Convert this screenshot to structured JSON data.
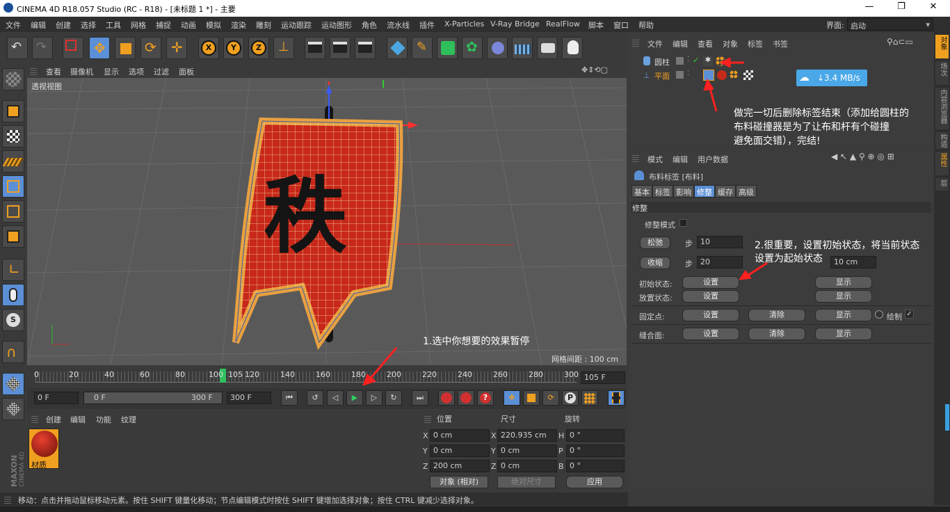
{
  "app": {
    "title": "CINEMA 4D R18.057 Studio (RC - R18) - [未标题 1 *] - 主要",
    "window_controls": [
      "—",
      "❐",
      "✕"
    ]
  },
  "menubar": {
    "items": [
      "文件",
      "编辑",
      "创建",
      "选择",
      "工具",
      "网格",
      "捕捉",
      "动画",
      "模拟",
      "渲染",
      "雕刻",
      "运动跟踪",
      "运动图形",
      "角色",
      "流水线",
      "插件",
      "X-Particles",
      "V-Ray Bridge",
      "RealFlow",
      "脚本",
      "窗口",
      "帮助"
    ],
    "layout_label": "界面:",
    "layout_value": "启动"
  },
  "viewport": {
    "menu": [
      "查看",
      "摄像机",
      "显示",
      "选项",
      "过滤",
      "面板"
    ],
    "view_name": "透视视图",
    "grid_info": "网格间距 : 100 cm",
    "flag_text": "秩"
  },
  "timeline": {
    "ticks": [
      "0",
      "20",
      "40",
      "60",
      "80",
      "100",
      "105",
      "120",
      "140",
      "160",
      "180",
      "200",
      "220",
      "240",
      "260",
      "280",
      "300"
    ],
    "current_frame": "105 F",
    "progress": 0.35
  },
  "transport": {
    "start": "0 F",
    "range_start": "0 F",
    "range_end": "300 F",
    "end": "300 F"
  },
  "material_panel": {
    "menu": [
      "创建",
      "编辑",
      "功能",
      "纹理"
    ],
    "material_name": "材质"
  },
  "coords": {
    "headers": [
      "位置",
      "尺寸",
      "旋转"
    ],
    "rows": [
      {
        "axis": "X",
        "pos": "0 cm",
        "size_axis": "X",
        "size": "220.935 cm",
        "rot_axis": "H",
        "rot": "0 °"
      },
      {
        "axis": "Y",
        "pos": "0 cm",
        "size_axis": "Y",
        "size": "0 cm",
        "rot_axis": "P",
        "rot": "0 °"
      },
      {
        "axis": "Z",
        "pos": "200 cm",
        "size_axis": "Z",
        "size": "0 cm",
        "rot_axis": "B",
        "rot": "0 °"
      }
    ],
    "mode": "对象 (相对)",
    "size_mode": "绝对尺寸",
    "apply": "应用"
  },
  "object_manager": {
    "menu": [
      "文件",
      "编辑",
      "查看",
      "对象",
      "标签",
      "书签"
    ],
    "objects": [
      {
        "name": "圆柱"
      },
      {
        "name": "平面"
      }
    ],
    "speed_badge": "3.4 MB/s"
  },
  "side_tabs": [
    "对象",
    "场次",
    "内容浏览器",
    "构造",
    "属性",
    "层"
  ],
  "attr_manager": {
    "menu": [
      "模式",
      "编辑",
      "用户数据"
    ],
    "tag_title": "布料标签 [布料]",
    "tabs": [
      "基本",
      "标签",
      "影响",
      "修整",
      "缓存",
      "高级"
    ],
    "active_tab": "修整",
    "section": "修整",
    "dress_mode_label": "修整模式",
    "relax_btn": "松弛",
    "step_label": "步",
    "relax_steps": "10",
    "shrink_btn": "收缩",
    "shrink_steps": "20",
    "width_value": "10 cm",
    "init_state_label": "初始状态:",
    "place_state_label": "放置状态:",
    "fix_points_label": "固定点:",
    "seam_label": "缝合面:",
    "set_btn": "设置",
    "show_btn": "显示",
    "clear_btn": "清除",
    "draw_label": "绘制"
  },
  "annotations": {
    "note1": "1.选中你想要的效果暂停",
    "note2_line1": "2.很重要，设置初始状态，将当前状态",
    "note2_line2": "设置为起始状态",
    "note3_line1": "做完一切后删除标签结束（添加给圆柱的",
    "note3_line2": "布料碰撞器是为了让布和杆有个碰撞",
    "note3_line3": "避免面交错），完结!"
  },
  "statusbar": {
    "text": "移动：点击并拖动鼠标移动元素。按住 SHIFT 键量化移动；节点编辑模式时按住 SHIFT 键增加选择对象；按住 CTRL 键减少选择对象。"
  },
  "colors": {
    "accent": "#5b8fd6",
    "highlight_orange": "#f0a020",
    "flag_red": "#c8281a",
    "annotation_arrow": "#ff2020"
  }
}
